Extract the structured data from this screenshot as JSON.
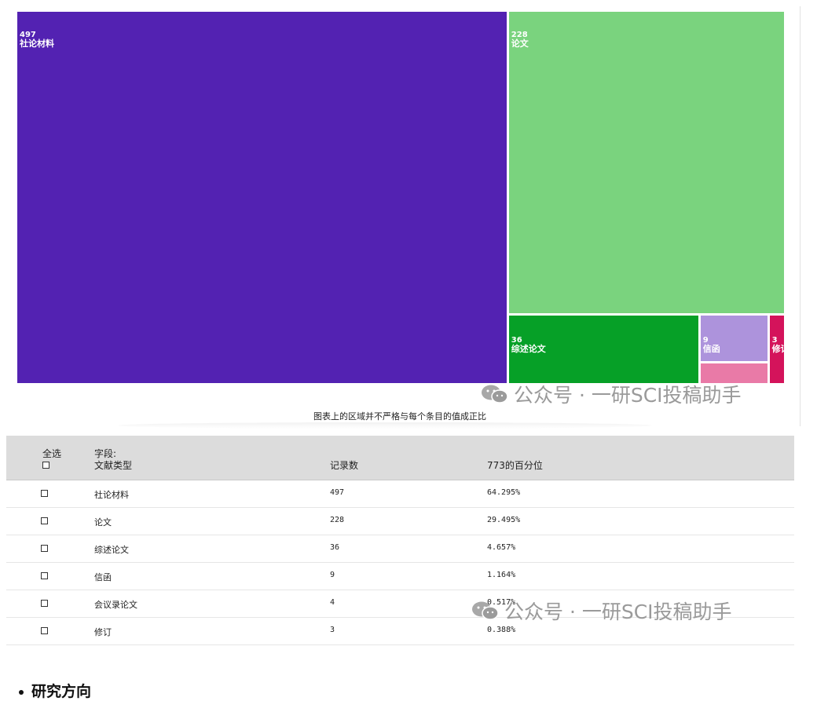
{
  "chart_data": {
    "type": "treemap",
    "field": "文献类型",
    "total": 773,
    "categories": [
      "社论材料",
      "论文",
      "综述论文",
      "信函",
      "会议录论文",
      "修订"
    ],
    "values": [
      497,
      228,
      36,
      9,
      4,
      3
    ],
    "colors": [
      "#5322b2",
      "#7ad37e",
      "#06a027",
      "#ad93dc",
      "#e97aa7",
      "#d4135b"
    ],
    "caption": "图表上的区域并不严格与每个条目的值成正比"
  },
  "table": {
    "headers": {
      "select_all": "全选",
      "field_prefix": "字段:",
      "field_name": "文献类型",
      "count": "记录数",
      "percent": "773的百分位"
    },
    "rows": [
      {
        "type": "社论材料",
        "count": "497",
        "percent": "64.295%"
      },
      {
        "type": "论文",
        "count": "228",
        "percent": "29.495%"
      },
      {
        "type": "综述论文",
        "count": "36",
        "percent": "4.657%"
      },
      {
        "type": "信函",
        "count": "9",
        "percent": "1.164%"
      },
      {
        "type": "会议录论文",
        "count": "4",
        "percent": "0.517%"
      },
      {
        "type": "修订",
        "count": "3",
        "percent": "0.388%"
      }
    ]
  },
  "watermark": {
    "text": "公众号 · 一研SCI投稿助手"
  },
  "section": {
    "title": "研究方向"
  },
  "icons": {
    "watermark": "wechat-icon",
    "row_select": "checkbox-icon"
  }
}
